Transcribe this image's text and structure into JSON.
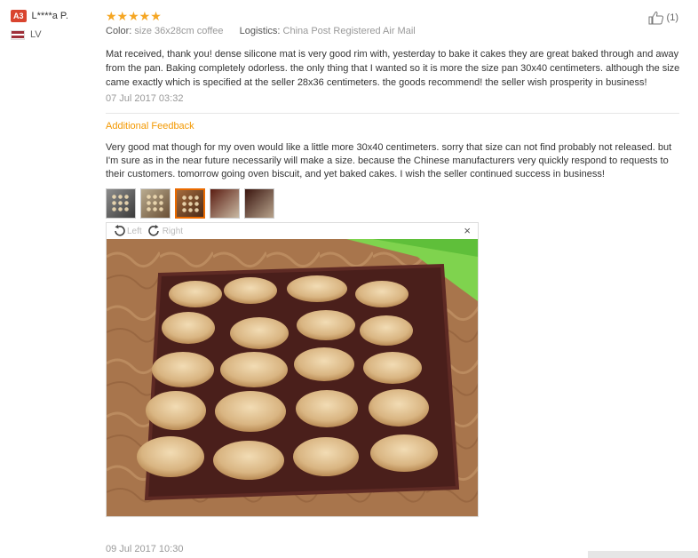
{
  "user": {
    "level_badge": "A3",
    "name": "L****a P.",
    "country": "LV"
  },
  "review": {
    "stars": "★★★★★",
    "color_label": "Color:",
    "color_value": "size 36x28cm coffee",
    "logistics_label": "Logistics:",
    "logistics_value": "China Post Registered Air Mail",
    "text": "Mat received, thank you! dense silicone mat is very good rim with, yesterday to bake it cakes they are great baked through and away from the pan. Baking completely odorless. the only thing that I wanted so it is more the size pan 30x40 centimeters. although the size came exactly which is specified at the seller 28x36 centimeters. the goods recommend! the seller wish prosperity in business!",
    "date": "07 Jul 2017 03:32",
    "likes": "(1)"
  },
  "additional": {
    "title": "Additional Feedback",
    "text": "Very good mat though for my oven would like a little more 30x40 centimeters. sorry that size can not find probably not released. but I'm sure as in the near future necessarily will make a size. because the Chinese manufacturers very quickly respond to requests to their customers. tomorrow going oven biscuit, and yet baked cakes. I wish the seller continued success in business!",
    "date": "09 Jul 2017 10:30"
  },
  "viewer": {
    "rotate_left": "Left",
    "rotate_right": "Right",
    "close": "×"
  },
  "colors": {
    "accent": "#f39800",
    "star": "#f5a623",
    "badge": "#d9442f"
  }
}
